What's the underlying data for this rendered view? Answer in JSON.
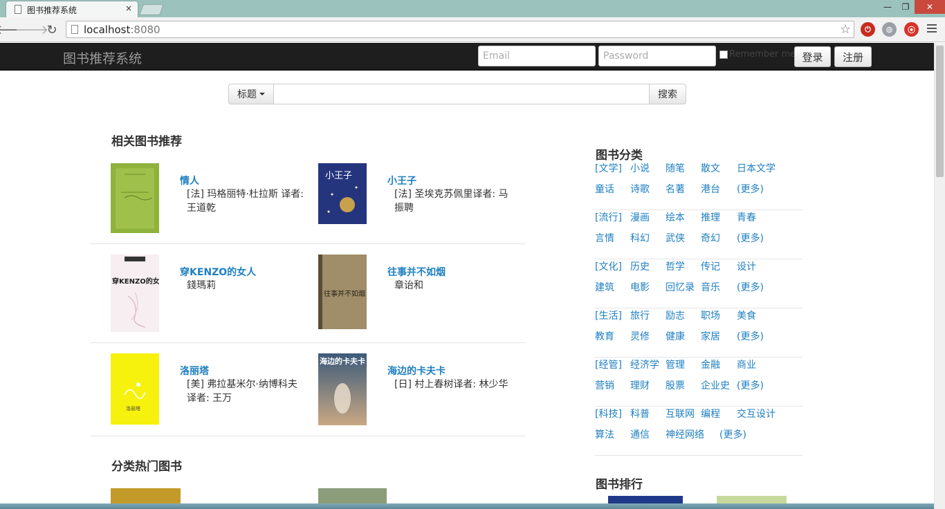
{
  "browser": {
    "tab_title": "图书推荐系统",
    "tab_close": "×",
    "url_host": "localhost",
    "url_port": ":8080",
    "window_controls": {
      "minimize": "—",
      "restore": "❐",
      "close": "✕"
    }
  },
  "navbar": {
    "brand": "图书推荐系统",
    "email_placeholder": "Email",
    "password_placeholder": "Password",
    "remember_label": "Remember me",
    "login_label": "登录",
    "register_label": "注册"
  },
  "search": {
    "field_label": "标题",
    "query": "",
    "button_label": "搜索"
  },
  "recommend": {
    "heading": "相关图书推荐",
    "books": [
      {
        "title": "情人",
        "author": "[法] 玛格丽特·杜拉斯 译者: 王道乾",
        "cover_color": "#8fb23c"
      },
      {
        "title": "小王子",
        "author": "[法] 圣埃克苏佩里译者: 马振聘",
        "cover_color": "#26347a"
      },
      {
        "title": "穿KENZO的女人",
        "author": "錢瑪莉",
        "cover_color": "#f1dfe6"
      },
      {
        "title": "往事并不如烟",
        "author": "章诒和",
        "cover_color": "#9c8a66"
      },
      {
        "title": "洛丽塔",
        "author": "[美] 弗拉基米尔·纳博科夫 译者: 王万",
        "cover_color": "#f4f10f"
      },
      {
        "title": "海边的卡夫卡",
        "author": "[日] 村上春树译者: 林少华",
        "cover_color": "#4b6a86"
      }
    ]
  },
  "hot": {
    "heading": "分类热门图书"
  },
  "categories": {
    "heading": "图书分类",
    "groups": [
      {
        "links": [
          "[文学]",
          "小说",
          "随笔",
          "散文",
          "日本文学",
          "童话",
          "诗歌",
          "名著",
          "港台",
          "(更多)"
        ]
      },
      {
        "links": [
          "[流行]",
          "漫画",
          "绘本",
          "推理",
          "青春",
          "言情",
          "科幻",
          "武侠",
          "奇幻",
          "(更多)"
        ]
      },
      {
        "links": [
          "[文化]",
          "历史",
          "哲学",
          "传记",
          "设计",
          "建筑",
          "电影",
          "回忆录",
          "音乐",
          "(更多)"
        ]
      },
      {
        "links": [
          "[生活]",
          "旅行",
          "励志",
          "职场",
          "美食",
          "教育",
          "灵修",
          "健康",
          "家居",
          "(更多)"
        ]
      },
      {
        "links": [
          "[经管]",
          "经济学",
          "管理",
          "金融",
          "商业",
          "营销",
          "理财",
          "股票",
          "企业史",
          "(更多)"
        ]
      },
      {
        "links": [
          "[科技]",
          "科普",
          "互联网",
          "编程",
          "交互设计",
          "算法",
          "通信",
          "神经网络",
          "(更多)"
        ]
      }
    ]
  },
  "ranking": {
    "heading": "图书排行"
  },
  "colors": {
    "link": "#1e7fc1",
    "navbar": "#1e1e1e",
    "tabstrip": "#9bc2bd"
  }
}
